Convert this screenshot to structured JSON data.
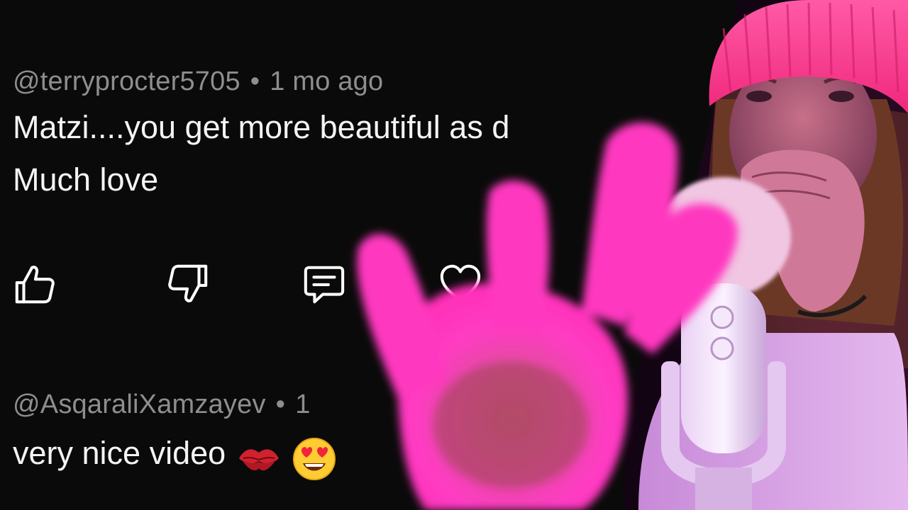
{
  "comments": [
    {
      "username": "@terryprocter5705",
      "time": "1 mo ago",
      "lines": [
        "Matzi....you get more beautiful as d",
        "Much love"
      ]
    },
    {
      "username": "@AsqaraliXamzayev",
      "time": "1",
      "text": "very nice video"
    }
  ],
  "actions": [
    {
      "icon": "thumbs-up-icon",
      "label": "Like"
    },
    {
      "icon": "thumbs-down-icon",
      "label": "Dislike"
    },
    {
      "icon": "comment-icon",
      "label": "Reply"
    },
    {
      "icon": "heart-icon",
      "label": "Heart"
    }
  ],
  "theme": {
    "background": "#0a0a0a",
    "meta_color": "#8e8e8e",
    "text_color": "#f4f4f4",
    "beanie_color": "#ff3d8f",
    "light_color": "#e83cc8"
  }
}
